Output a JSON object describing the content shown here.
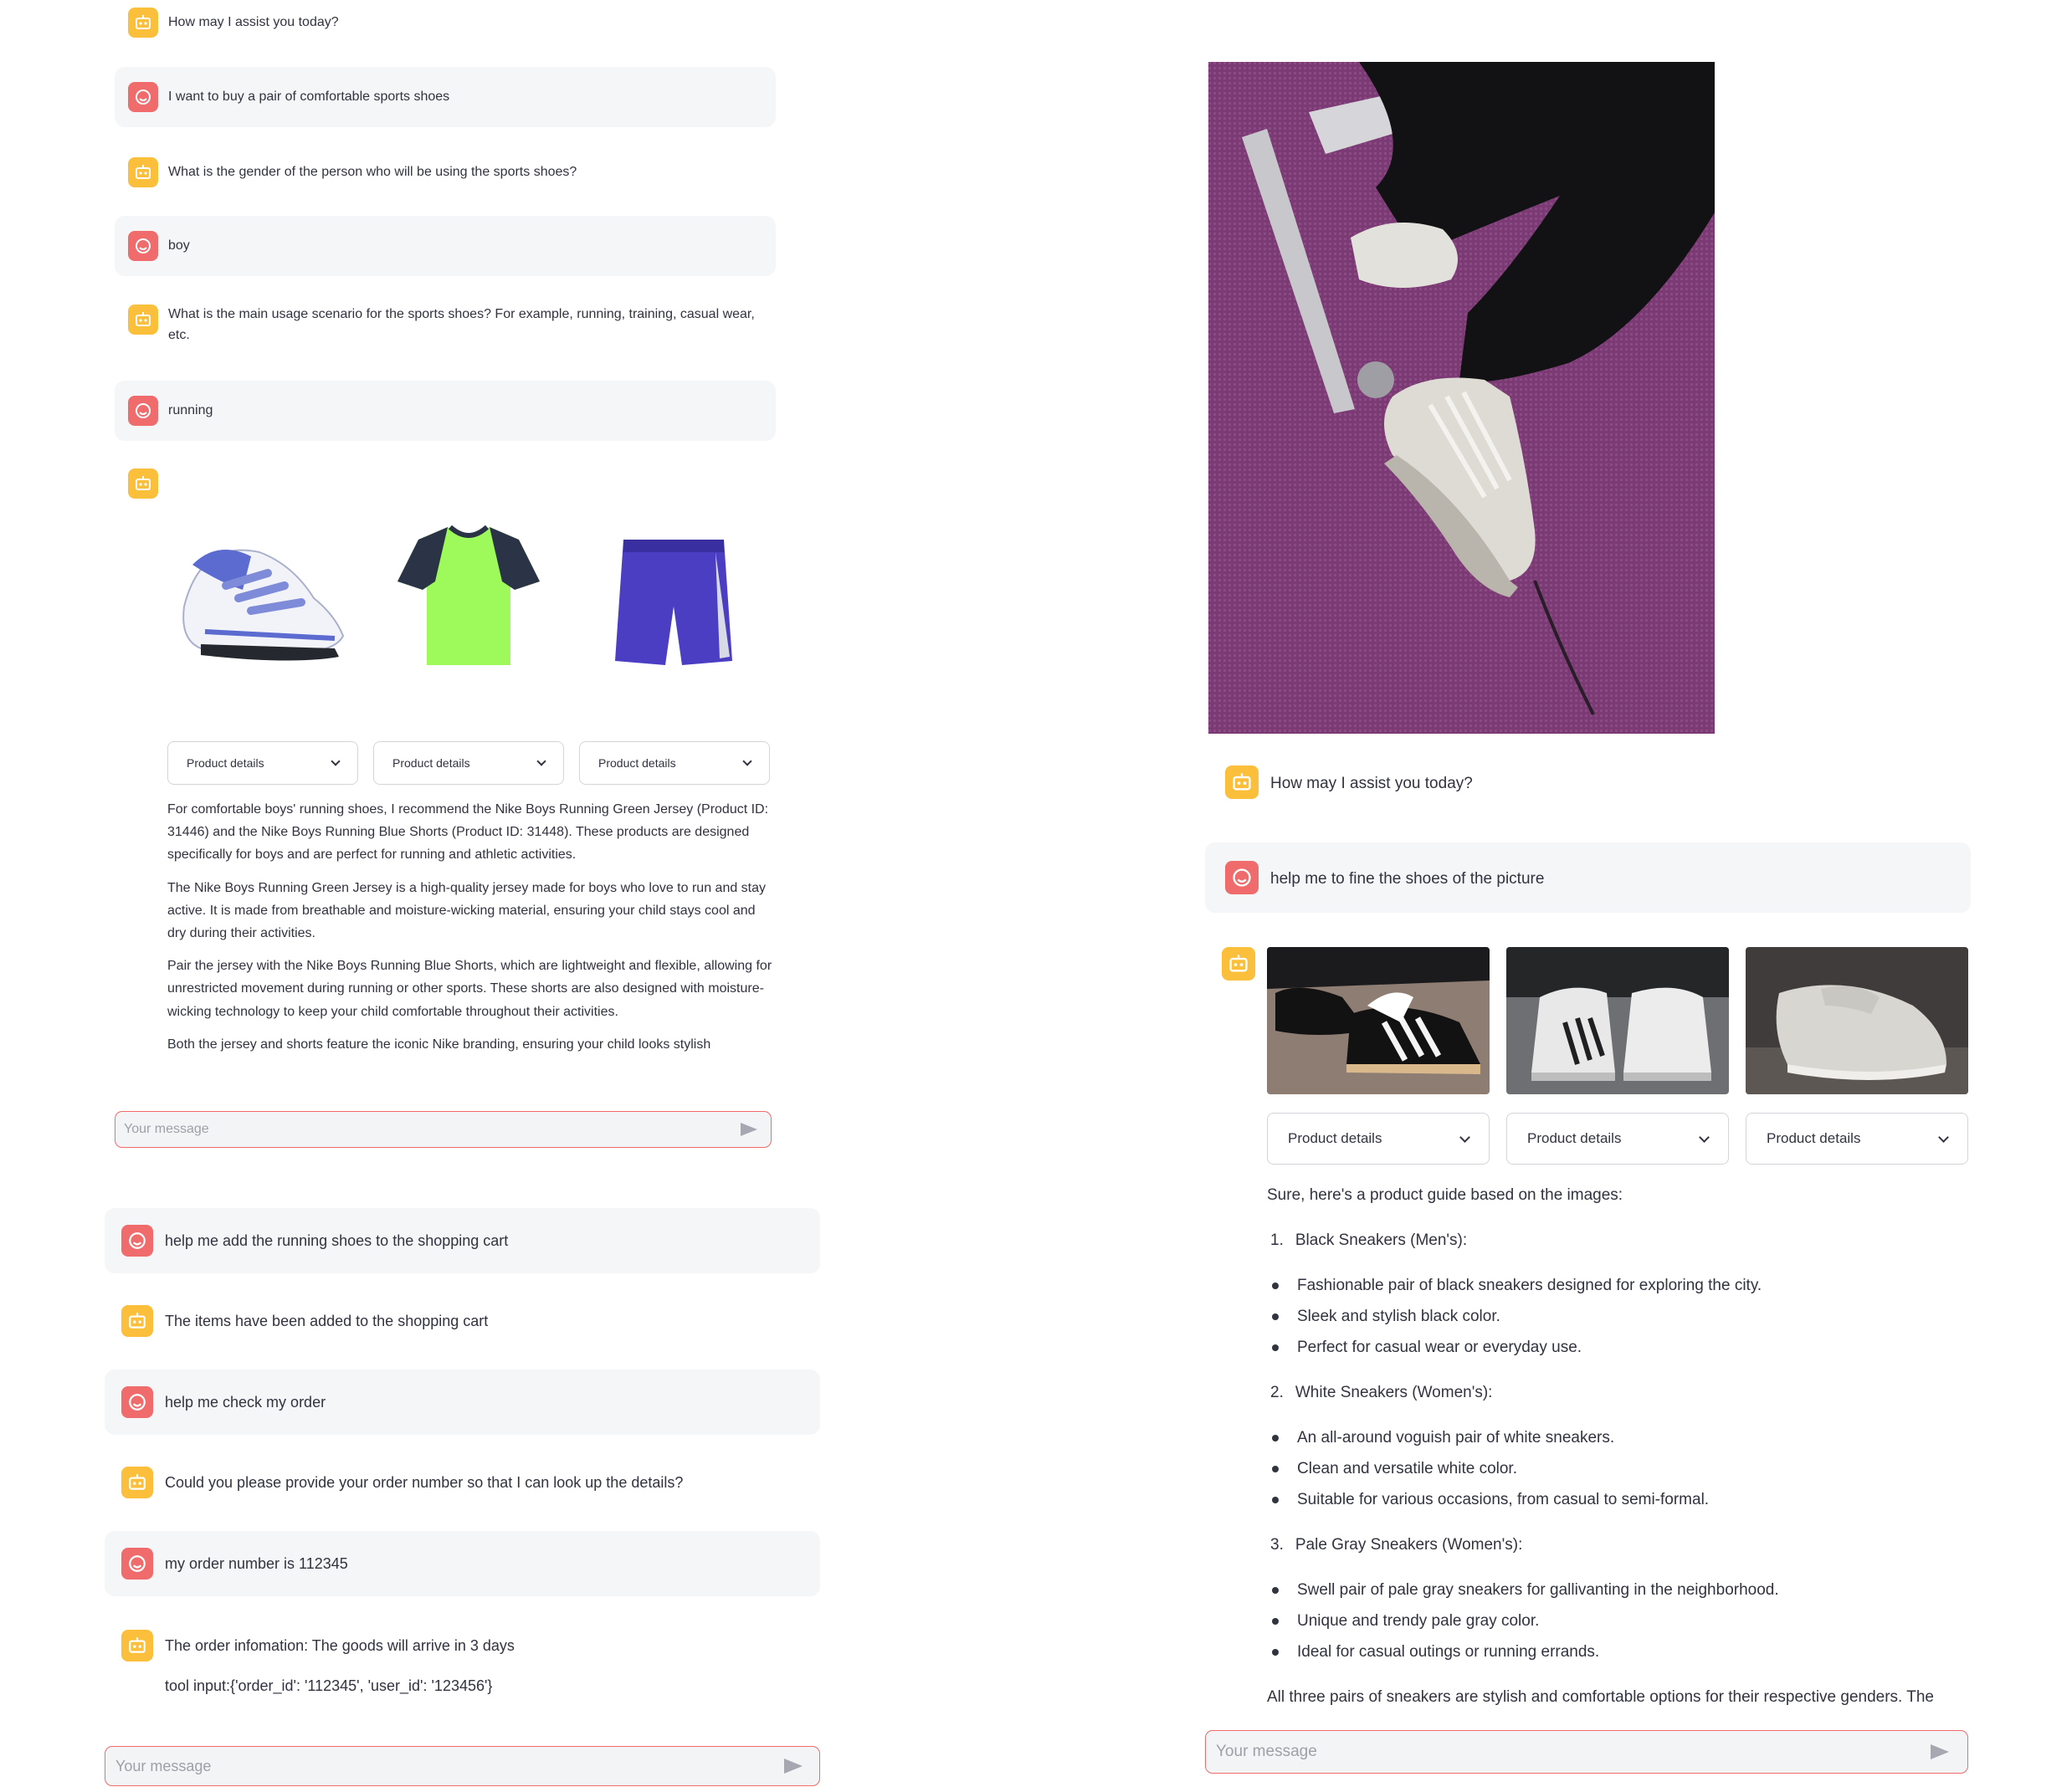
{
  "section1": {
    "messages": [
      {
        "role": "assistant",
        "text": "How may I assist you today?"
      },
      {
        "role": "user",
        "text": "I want to buy a pair of comfortable sports shoes"
      },
      {
        "role": "assistant",
        "text": "What is the gender of the person who will be using the sports shoes?"
      },
      {
        "role": "user",
        "text": "boy"
      },
      {
        "role": "assistant",
        "text": "What is the main usage scenario for the sports shoes? For example, running, training, casual wear, etc."
      },
      {
        "role": "user",
        "text": "running"
      }
    ],
    "products": [
      {
        "icon": "running-shoe-image",
        "details_label": "Product details"
      },
      {
        "icon": "green-jersey-image",
        "details_label": "Product details"
      },
      {
        "icon": "blue-shorts-image",
        "details_label": "Product details"
      }
    ],
    "paragraphs": [
      "For comfortable boys' running shoes, I recommend the Nike Boys Running Green Jersey (Product ID: 31446) and the Nike Boys Running Blue Shorts (Product ID: 31448). These products are designed specifically for boys and are perfect for running and athletic activities.",
      "The Nike Boys Running Green Jersey is a high-quality jersey made for boys who love to run and stay active. It is made from breathable and moisture-wicking material, ensuring your child stays cool and dry during their activities.",
      "Pair the jersey with the Nike Boys Running Blue Shorts, which are lightweight and flexible, allowing for unrestricted movement during running or other sports. These shorts are also designed with moisture-wicking technology to keep your child comfortable throughout their activities.",
      "Both the jersey and shorts feature the iconic Nike branding, ensuring your child looks stylish"
    ],
    "input_placeholder": "Your message"
  },
  "section2": {
    "messages": [
      {
        "role": "user",
        "text": "help me add the running shoes to the shopping cart"
      },
      {
        "role": "assistant",
        "text": "The items have been added to the shopping cart"
      },
      {
        "role": "user",
        "text": "help me check my order"
      },
      {
        "role": "assistant",
        "text": "Could you please provide your order number so that I can look up the details?"
      },
      {
        "role": "user",
        "text": "my order number is 112345"
      },
      {
        "role": "assistant",
        "text": "The order infomation: The goods will arrive in 3 days",
        "extra": "tool input:{'order_id': '112345', 'user_id': '123456'}"
      }
    ],
    "input_placeholder": "Your message"
  },
  "section3": {
    "uploaded_image": "photo-of-white-sneakers-on-purple-carpet",
    "messages": [
      {
        "role": "assistant",
        "text": "How may I assist you today?"
      },
      {
        "role": "user",
        "text": "help me to fine the shoes of the picture"
      }
    ],
    "products": [
      {
        "icon": "black-sneakers-image",
        "details_label": "Product details"
      },
      {
        "icon": "white-high-top-sneakers-image",
        "details_label": "Product details"
      },
      {
        "icon": "pale-gray-sneakers-image",
        "details_label": "Product details"
      }
    ],
    "intro": "Sure, here's a product guide based on the images:",
    "guide": [
      {
        "number": "1.",
        "title": "Black Sneakers (Men's):",
        "bullets": [
          "Fashionable pair of black sneakers designed for exploring the city.",
          "Sleek and stylish black color.",
          "Perfect for casual wear or everyday use."
        ]
      },
      {
        "number": "2.",
        "title": "White Sneakers (Women's):",
        "bullets": [
          "An all-around voguish pair of white sneakers.",
          "Clean and versatile white color.",
          "Suitable for various occasions, from casual to semi-formal."
        ]
      },
      {
        "number": "3.",
        "title": "Pale Gray Sneakers (Women's):",
        "bullets": [
          "Swell pair of pale gray sneakers for gallivanting in the neighborhood.",
          "Unique and trendy pale gray color.",
          "Ideal for casual outings or running errands."
        ]
      }
    ],
    "outro": "All three pairs of sneakers are stylish and comfortable options for their respective genders. The",
    "input_placeholder": "Your message"
  },
  "colors": {
    "user_avatar": "#f06c6c",
    "assistant_avatar": "#fbbf3c",
    "input_border": "#f26a6a",
    "user_bubble": "#f5f6f8"
  }
}
